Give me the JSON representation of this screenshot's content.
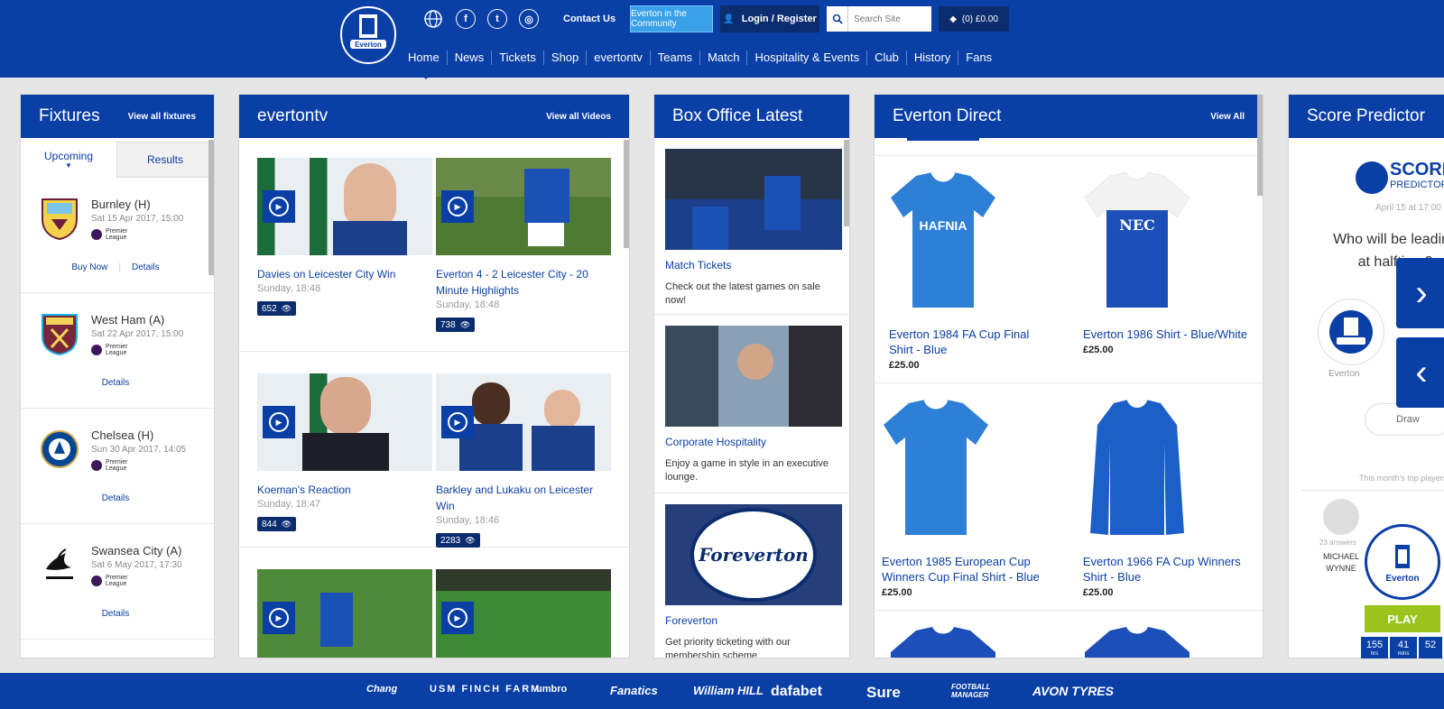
{
  "utility": {
    "contact": "Contact Us",
    "community": "Everton in the Community",
    "login": "Login / Register",
    "search_placeholder": "Search Site",
    "basket": "(0) £0.00"
  },
  "nav": [
    "Home",
    "News",
    "Tickets",
    "Shop",
    "evertontv",
    "Teams",
    "Match",
    "Hospitality & Events",
    "Club",
    "History",
    "Fans"
  ],
  "fixtures": {
    "title": "Fixtures",
    "link": "View all fixtures",
    "tab_upcoming": "Upcoming",
    "tab_results": "Results",
    "league": [
      "Premier",
      "League"
    ],
    "items": [
      {
        "team": "Burnley (H)",
        "date": "Sat 15 Apr 2017, 15:00",
        "buy": "Buy Now",
        "details": "Details"
      },
      {
        "team": "West Ham (A)",
        "date": "Sat 22 Apr 2017, 15:00",
        "details": "Details"
      },
      {
        "team": "Chelsea (H)",
        "date": "Sun 30 Apr 2017, 14:05",
        "details": "Details"
      },
      {
        "team": "Swansea City (A)",
        "date": "Sat 6 May 2017, 17:30",
        "details": "Details"
      }
    ]
  },
  "tv": {
    "title": "evertontv",
    "link": "View all Videos",
    "videos": [
      {
        "title": "Davies on Leicester City Win",
        "date": "Sunday, 18:48",
        "views": "652"
      },
      {
        "title": "Everton 4 - 2 Leicester City - 20 Minute Highlights",
        "date": "Sunday, 18:48",
        "views": "738"
      },
      {
        "title": "Koeman's Reaction",
        "date": "Sunday, 18:47",
        "views": "844"
      },
      {
        "title": "Barkley and Lukaku on Leicester Win",
        "date": "Sunday, 18:46",
        "views": "2283"
      }
    ]
  },
  "box_office": {
    "title": "Box Office Latest",
    "items": [
      {
        "title": "Match Tickets",
        "desc": "Check out the latest games on sale now!"
      },
      {
        "title": "Corporate Hospitality",
        "desc": "Enjoy a game in style in an executive lounge."
      },
      {
        "title": "Foreverton",
        "desc": "Get priority ticketing with our membership scheme",
        "img_text": "Foreverton"
      }
    ]
  },
  "direct": {
    "title": "Everton Direct",
    "link": "View All",
    "products": [
      {
        "name": "Everton 1984 FA Cup Final Shirt - Blue",
        "price": "£25.00",
        "sponsor": "HAFNIA"
      },
      {
        "name": "Everton 1986 Shirt - Blue/White",
        "price": "£25.00",
        "sponsor": "NEC"
      },
      {
        "name": "Everton 1985 European Cup Winners Cup Final Shirt - Blue",
        "price": "£25.00"
      },
      {
        "name": "Everton 1966 FA Cup Winners Shirt - Blue",
        "price": "£25.00"
      }
    ]
  },
  "predictor": {
    "title": "Score Predictor",
    "logo_top": "SCORE",
    "logo_bottom": "PREDICTOR",
    "date": "April 15 at 17:00",
    "question": "Who will be leading at halftime?",
    "team": "Everton",
    "draw": "Draw",
    "top_players": "This month's top players",
    "answers": "23 answers",
    "player": "MICHAEL WYNNE",
    "play": "PLAY",
    "countdown": [
      {
        "v": "155",
        "u": "hrs"
      },
      {
        "v": "41",
        "u": "mins"
      },
      {
        "v": "52",
        "u": ""
      }
    ]
  },
  "sponsors": [
    "Chang",
    "USM FINCH FARM",
    "umbro",
    "Fanatics",
    "William HILL",
    "dafabet",
    "Sure",
    "FOOTBALL MANAGER",
    "AVON TYRES"
  ],
  "crest_text": "Everton"
}
